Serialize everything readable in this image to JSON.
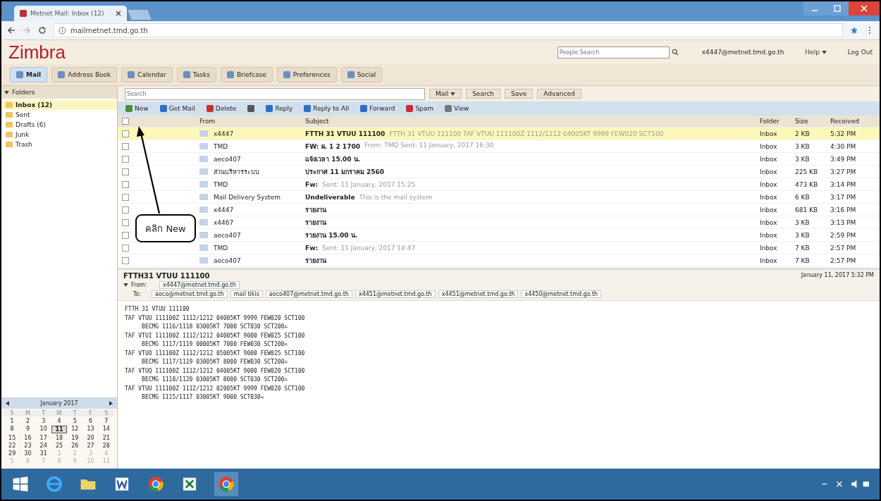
{
  "browser": {
    "tab_title": "Metnet Mail: Inbox (12)",
    "url": "mailmetnet.tmd.go.th"
  },
  "header": {
    "logo": "Zimbra",
    "people_search": {
      "placeholder": "People Search"
    },
    "user": "x4447@metnet.tmd.go.th",
    "help": "Help",
    "logout": "Log Out"
  },
  "app_tabs": [
    {
      "label": "Mail",
      "selected": true
    },
    {
      "label": "Address Book",
      "selected": false
    },
    {
      "label": "Calendar",
      "selected": false
    },
    {
      "label": "Tasks",
      "selected": false
    },
    {
      "label": "Briefcase",
      "selected": false
    },
    {
      "label": "Preferences",
      "selected": false
    },
    {
      "label": "Social",
      "selected": false
    }
  ],
  "sidebar": {
    "title": "Folders",
    "folders": [
      {
        "label": "Inbox (12)",
        "selected": true
      },
      {
        "label": "Sent",
        "selected": false
      },
      {
        "label": "Drafts (6)",
        "selected": false
      },
      {
        "label": "Junk",
        "selected": false
      },
      {
        "label": "Trash",
        "selected": false
      }
    ]
  },
  "calendar": {
    "title": "January 2017",
    "weekdays": [
      "S",
      "M",
      "T",
      "W",
      "T",
      "F",
      "S"
    ],
    "weeks": [
      [
        {
          "d": "1",
          "dim": false,
          "today": false
        },
        {
          "d": "2",
          "dim": false,
          "today": false
        },
        {
          "d": "3",
          "dim": false,
          "today": false
        },
        {
          "d": "4",
          "dim": false,
          "today": false
        },
        {
          "d": "5",
          "dim": false,
          "today": false
        },
        {
          "d": "6",
          "dim": false,
          "today": false
        },
        {
          "d": "7",
          "dim": false,
          "today": false
        }
      ],
      [
        {
          "d": "8",
          "dim": false,
          "today": false
        },
        {
          "d": "9",
          "dim": false,
          "today": false
        },
        {
          "d": "10",
          "dim": false,
          "today": false
        },
        {
          "d": "11",
          "dim": false,
          "today": true
        },
        {
          "d": "12",
          "dim": false,
          "today": false
        },
        {
          "d": "13",
          "dim": false,
          "today": false
        },
        {
          "d": "14",
          "dim": false,
          "today": false
        }
      ],
      [
        {
          "d": "15",
          "dim": false,
          "today": false
        },
        {
          "d": "16",
          "dim": false,
          "today": false
        },
        {
          "d": "17",
          "dim": false,
          "today": false
        },
        {
          "d": "18",
          "dim": false,
          "today": false
        },
        {
          "d": "19",
          "dim": false,
          "today": false
        },
        {
          "d": "20",
          "dim": false,
          "today": false
        },
        {
          "d": "21",
          "dim": false,
          "today": false
        }
      ],
      [
        {
          "d": "22",
          "dim": false,
          "today": false
        },
        {
          "d": "23",
          "dim": false,
          "today": false
        },
        {
          "d": "24",
          "dim": false,
          "today": false
        },
        {
          "d": "25",
          "dim": false,
          "today": false
        },
        {
          "d": "26",
          "dim": false,
          "today": false
        },
        {
          "d": "27",
          "dim": false,
          "today": false
        },
        {
          "d": "28",
          "dim": false,
          "today": false
        }
      ],
      [
        {
          "d": "29",
          "dim": false,
          "today": false
        },
        {
          "d": "30",
          "dim": false,
          "today": false
        },
        {
          "d": "31",
          "dim": false,
          "today": false
        },
        {
          "d": "1",
          "dim": true,
          "today": false
        },
        {
          "d": "2",
          "dim": true,
          "today": false
        },
        {
          "d": "3",
          "dim": true,
          "today": false
        },
        {
          "d": "4",
          "dim": true,
          "today": false
        }
      ],
      [
        {
          "d": "5",
          "dim": true,
          "today": false
        },
        {
          "d": "6",
          "dim": true,
          "today": false
        },
        {
          "d": "7",
          "dim": true,
          "today": false
        },
        {
          "d": "8",
          "dim": true,
          "today": false
        },
        {
          "d": "9",
          "dim": true,
          "today": false
        },
        {
          "d": "10",
          "dim": true,
          "today": false
        },
        {
          "d": "11",
          "dim": true,
          "today": false
        }
      ]
    ]
  },
  "search": {
    "placeholder": "Search",
    "scope": "Mail",
    "buttons": [
      "Search",
      "Save",
      "Advanced"
    ]
  },
  "toolbar": [
    {
      "kind": "new",
      "label": "New"
    },
    {
      "kind": "get",
      "label": "Get Mail"
    },
    {
      "kind": "delete",
      "label": "Delete"
    },
    {
      "kind": "print"
    },
    {
      "kind": "reply",
      "label": "Reply"
    },
    {
      "kind": "replyall",
      "label": "Reply to All"
    },
    {
      "kind": "forward",
      "label": "Forward"
    },
    {
      "kind": "spam",
      "label": "Spam"
    },
    {
      "kind": "view",
      "label": "View"
    }
  ],
  "select_all_checked": false,
  "columns": [
    "From",
    "Subject",
    "Folder",
    "Size",
    "Received"
  ],
  "rows": [
    {
      "from": "x4447",
      "subject": "FTTH 31 VTUU 111100",
      "fragment": "FTTH 31 VTUU 111100 TAF VTUU 111100Z 1112/1212 04005KT 9999 FEW020 SCT100",
      "folder": "Inbox",
      "size": "2 KB",
      "received": "5:32 PM",
      "selected": true
    },
    {
      "from": "TMD",
      "subject": "FW: ผ. 1 2 1700",
      "fragment": "From: TMD Sent: 11 January, 2017 16:30",
      "folder": "Inbox",
      "size": "3 KB",
      "received": "4:30 PM",
      "selected": false
    },
    {
      "from": "aeco407",
      "subject": "แจ้งเวลา 15.00 น.",
      "fragment": "",
      "folder": "Inbox",
      "size": "3 KB",
      "received": "3:49 PM",
      "selected": false
    },
    {
      "from": "ส่วนบริหารระบบ",
      "subject": "ประกาศ 11 มกราคม 2560",
      "fragment": "",
      "folder": "Inbox",
      "size": "225 KB",
      "received": "3:27 PM",
      "selected": false
    },
    {
      "from": "TMD",
      "subject": "Fw:",
      "fragment": "Sent: 11 January, 2017 15:25",
      "folder": "Inbox",
      "size": "473 KB",
      "received": "3:14 PM",
      "selected": false
    },
    {
      "from": "Mail Delivery System",
      "subject": "Undeliverable",
      "fragment": "This is the mail system",
      "folder": "Inbox",
      "size": "6 KB",
      "received": "3:17 PM",
      "selected": false
    },
    {
      "from": "x4447",
      "subject": "รายงาน",
      "fragment": "",
      "folder": "Inbox",
      "size": "681 KB",
      "received": "3:16 PM",
      "selected": false
    },
    {
      "from": "x4467",
      "subject": "รายงาน",
      "fragment": "",
      "folder": "Inbox",
      "size": "3 KB",
      "received": "3:13 PM",
      "selected": false
    },
    {
      "from": "aeco407",
      "subject": "รายงาน 15.00 น.",
      "fragment": "",
      "folder": "Inbox",
      "size": "3 KB",
      "received": "2:59 PM",
      "selected": false
    },
    {
      "from": "TMD",
      "subject": "Fw:",
      "fragment": "Sent: 11 January, 2017 14:47",
      "folder": "Inbox",
      "size": "7 KB",
      "received": "2:57 PM",
      "selected": false
    },
    {
      "from": "aeco407",
      "subject": "รายงาน",
      "fragment": "",
      "folder": "Inbox",
      "size": "7 KB",
      "received": "2:57 PM",
      "selected": false
    }
  ],
  "reading": {
    "subject": "FTTH31 VTUU 111100",
    "date": "January 11, 2017 5:32 PM",
    "from_label": "From:",
    "from": "x4447@metnet.tmd.go.th",
    "to_label": "To:",
    "to": [
      "aeco@metnet.tmd.go.th",
      "mail tikis",
      "aeco407@metnet.tmd.go.th",
      "x4451@metnet.tmd.go.th",
      "x4451@metnet.tmd.go.th",
      "x4450@metnet.tmd.go.th"
    ],
    "body": [
      "FTTH 31 VTUU 111100",
      "TAF VTUU 111100Z 1112/1212 04005KT 9999 FEW020 SCT100",
      "     BECMG 1116/1118 03005KT 7000 SCT030 SCT200=",
      "TAF VTUI 111100Z 1112/1212 04005KT 9000 FEW025 SCT100",
      "     BECMG 1117/1119 00005KT 7000 FEW030 SCT200=",
      "TAF VTUO 111100Z 1112/1212 05005KT 9000 FEW025 SCT100",
      "     BECMG 1117/1119 03005KT 8000 FEW030 SCT200=",
      "TAF VTUQ 111100Z 1112/1212 04005KT 9000 FEW020 SCT100",
      "     BECMG 1118/1120 03005KT 8000 SCT030 SCT200=",
      "TAF VTUU 111100Z 1112/1212 02005KT 9999 FEW020 SCT100",
      "     BECMG 1115/1117 03005KT 9000 SCT030="
    ]
  },
  "callout": {
    "text": "คลิก New"
  }
}
